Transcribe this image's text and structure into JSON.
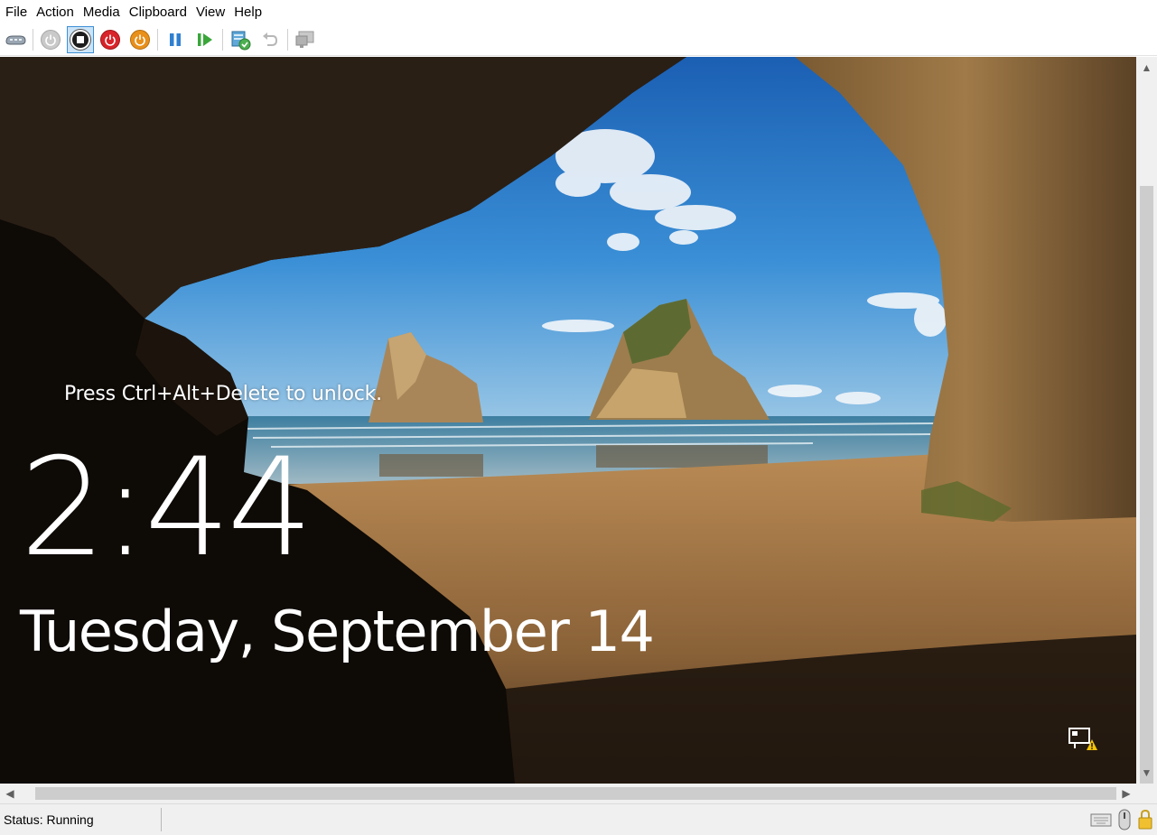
{
  "menubar": {
    "items": [
      "File",
      "Action",
      "Media",
      "Clipboard",
      "View",
      "Help"
    ]
  },
  "toolbar": {
    "buttons": [
      "ctrl-alt-del-icon",
      "start-icon",
      "turn-off-icon",
      "shut-down-icon",
      "save-state-icon",
      "pause-icon",
      "resume-icon",
      "checkpoint-icon",
      "revert-icon",
      "enhanced-session-icon"
    ],
    "pressed_button": "turn-off-icon"
  },
  "vm_screen": {
    "lock_hint": "Press Ctrl+Alt+Delete to unlock.",
    "time": "2:44",
    "date": "Tuesday, September 14"
  },
  "statusbar": {
    "status": "Status: Running",
    "icons": [
      "keyboard-icon",
      "mouse-icon",
      "lock-icon"
    ]
  },
  "colors": {
    "accent_pressed": "#cce4f7",
    "red_button": "#d9232a",
    "orange_button": "#e8901a",
    "blue_pause": "#2f7fd0",
    "green_play": "#3aa63a"
  }
}
